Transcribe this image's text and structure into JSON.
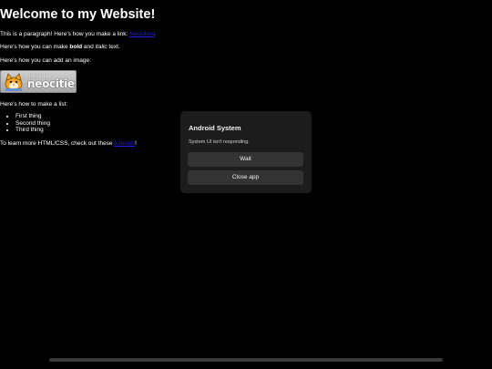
{
  "page": {
    "heading": "Welcome to my Website!",
    "para1_prefix": "This is a paragraph! Here's how you make a link: ",
    "para1_link": "Neocities",
    "para1_suffix": ".",
    "para2_prefix": "Here's how you can make ",
    "para2_bold": "bold",
    "para2_mid": " and ",
    "para2_italic": "italic",
    "para2_suffix": " text.",
    "para3": "Here's how you can add an image:",
    "badge_hosted": "hosted by",
    "badge_brand": "neocities",
    "para4": "Here's how to make a list:",
    "list_items": [
      "First thing",
      "Second thing",
      "Third thing"
    ],
    "para5_prefix": "To learn more HTML/CSS, check out these ",
    "para5_link": "tutorials",
    "para5_suffix": "!",
    "link_color": "#1e1ee6"
  },
  "dialog": {
    "title": "Android System",
    "message": "System UI isn't responding.",
    "wait_label": "Wait",
    "close_label": "Close app"
  }
}
